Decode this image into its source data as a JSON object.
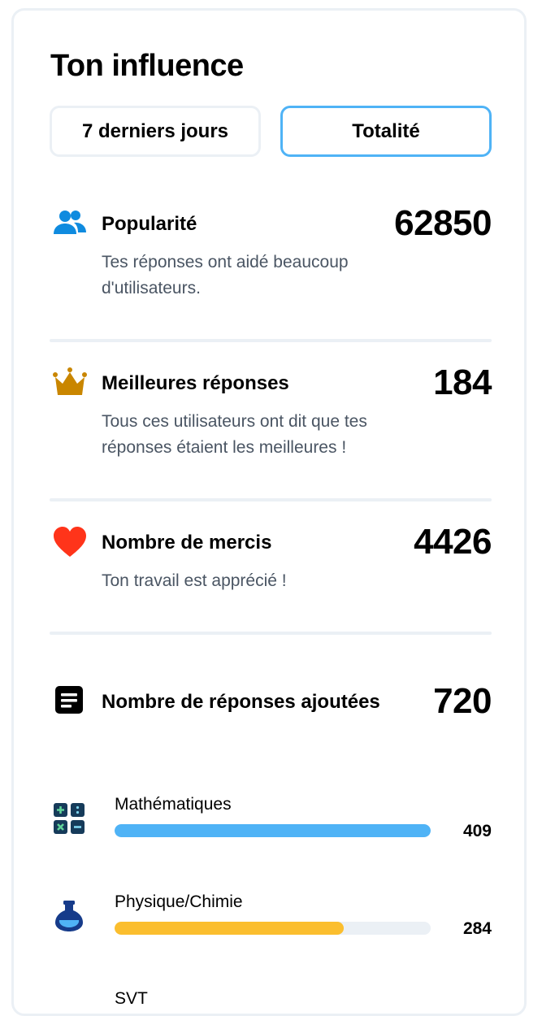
{
  "title": "Ton influence",
  "tabs": [
    {
      "label": "7 derniers jours"
    },
    {
      "label": "Totalité"
    }
  ],
  "stats": [
    {
      "icon": "users-icon",
      "label": "Popularité",
      "value": "62850",
      "desc": "Tes réponses ont aidé beaucoup d'utilisateurs.",
      "color": "#0f8bdf"
    },
    {
      "icon": "crown-icon",
      "label": "Meilleures réponses",
      "value": "184",
      "desc": "Tous ces utilisateurs ont dit que tes réponses étaient les meilleures !",
      "color": "#c98600"
    },
    {
      "icon": "heart-icon",
      "label": "Nombre de mercis",
      "value": "4426",
      "desc": "Ton travail est apprécié !",
      "color": "#ff341a"
    },
    {
      "icon": "answers-icon",
      "label": "Nombre de réponses ajoutées",
      "value": "720",
      "desc": "",
      "color": "#000000"
    }
  ],
  "subjects": [
    {
      "icon": "calculator-icon",
      "name": "Mathématiques",
      "count": "409",
      "fraction": 1.0,
      "color": "#4fb3f6"
    },
    {
      "icon": "flask-icon",
      "name": "Physique/Chimie",
      "count": "284",
      "fraction": 0.725,
      "color": "#fbbe2e"
    },
    {
      "name": "SVT"
    }
  ]
}
